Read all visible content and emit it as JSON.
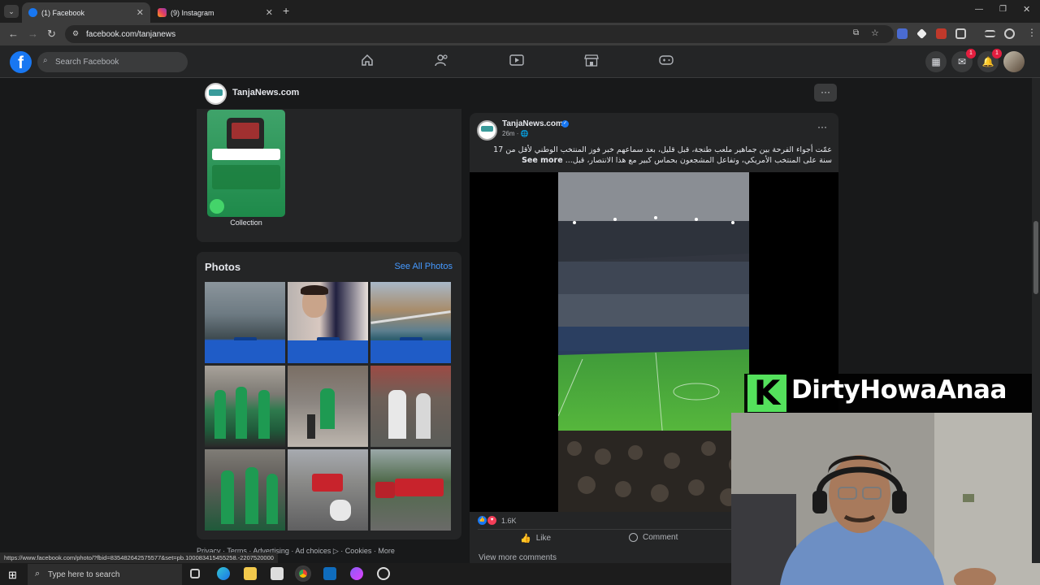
{
  "browser": {
    "tabs": [
      {
        "title": "(1) Facebook",
        "active": true,
        "favicon": "facebook-icon"
      },
      {
        "title": "(9) Instagram",
        "active": false,
        "favicon": "instagram-icon"
      }
    ],
    "url": "facebook.com/tanjanews",
    "status_url": "https://www.facebook.com/photo/?fbid=835482642575577&set=pb.100083415455258.-2207520000"
  },
  "fb_header": {
    "search_placeholder": "Search Facebook",
    "messenger_badge": "1",
    "notifications_badge": "1",
    "nav_icons": [
      "home-icon",
      "friends-icon",
      "watch-icon",
      "marketplace-icon",
      "gaming-icon"
    ]
  },
  "page": {
    "name": "TanjaNews.com"
  },
  "collection": {
    "label": "Collection"
  },
  "photos": {
    "title": "Photos",
    "see_all": "See All Photos"
  },
  "footer": {
    "text": "Privacy · Terms · Advertising · Ad choices ▷ · Cookies · More"
  },
  "post": {
    "author": "TanjaNews.com",
    "time": "26m · 🌐",
    "text": "عمّت أجواء الفرحة بين جماهير ملعب طنجة، قبل قليل، بعد سماعهم خبر فوز المنتخب الوطني لأقل من 17 سنة على المنتخب الأمريكي، وتفاعل المشجعون بحماس كبير مع هذا الانتصار، قبل...",
    "see_more": "See more",
    "reactions_count": "1.6K",
    "like_label": "Like",
    "comment_label": "Comment",
    "view_comments": "View more comments"
  },
  "overlay": {
    "logo_letter": "K",
    "channel_name": "DirtyHowaAnaa"
  },
  "taskbar": {
    "search_placeholder": "Type here to search"
  },
  "colors": {
    "fb_blue": "#1877f2",
    "link_blue": "#4599ff",
    "kick_green": "#54e15c"
  }
}
